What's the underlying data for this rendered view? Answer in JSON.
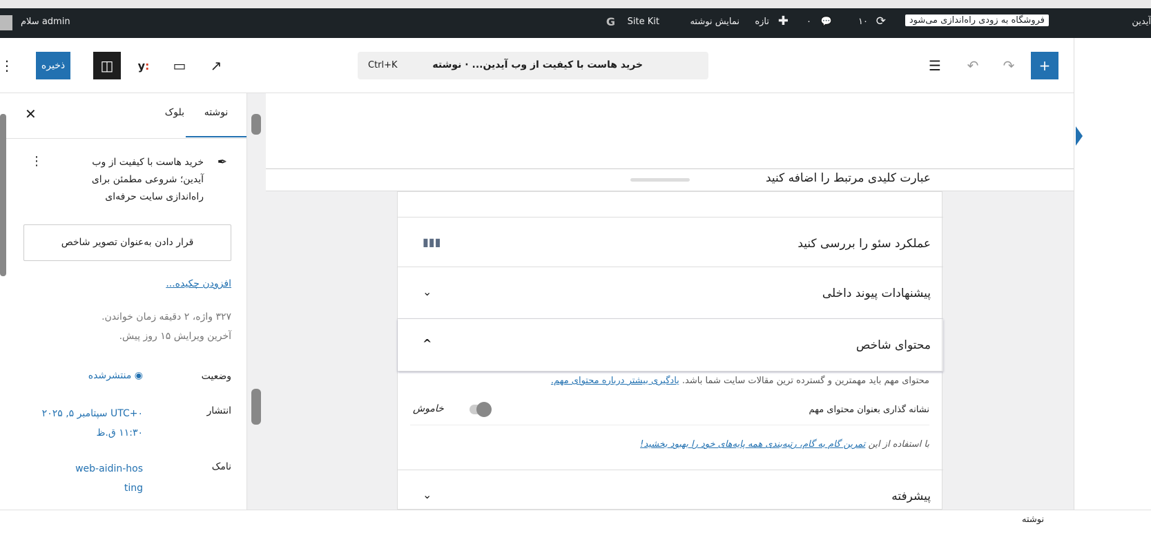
{
  "adminbar": {
    "site": "آیدین",
    "notice": "فروشگاه به زودی راه‌اندازی می‌شود",
    "updates": "۱۰",
    "comments": "۰",
    "new": "تازه",
    "view_post": "نمایش نوشته",
    "sitekit": "Site Kit",
    "greeting": "سلام admin"
  },
  "toolbar": {
    "save": "ذخیره",
    "doc_title": "خرید هاست با کیفیت از وب آیدین... · نوشته",
    "shortcut": "Ctrl+K"
  },
  "sidebar": {
    "tabs": [
      {
        "label": "نوشته"
      },
      {
        "label": "بلوک"
      }
    ],
    "post_title": "خرید هاست با کیفیت از وب آیدین؛ شروعی مطمئن برای راه‌اندازی سایت حرفه‌ای",
    "featured_image": "قرار دادن به‌عنوان تصویر شاخص",
    "excerpt_link": "افزودن چکیده...",
    "stats": "۳۲۷ واژه، ۲ دقیقه زمان خواندن.",
    "last_edit": "آخرین ویرایش ۱۵ روز پیش.",
    "status_label": "وضعیت",
    "status_value": "منتشرشده",
    "publish_label": "انتشار",
    "publish_value": "UTC+۰ سپتامبر ۵, ۲۰۲۵ ۱۱:۳۰ ق.ظ",
    "slug_label": "نامک",
    "slug_value": "web-aidin-hosting"
  },
  "yoast": {
    "keyphrase": "عبارت کلیدی مرتبط را اضافه کنید",
    "seo": "عملکرد سئو را بررسی کنید",
    "links": "پیشنهادات پیوند داخلی",
    "cornerstone": "محتوای شاخص",
    "cornerstone_desc": "محتوای مهم باید مهمترین و گسترده ترین مقالات سایت شما باشد.",
    "cornerstone_link": "یادگیری بیشتر درباره محتوای مهم.",
    "toggle_label": "نشانه گذاری بعنوان محتوای مهم",
    "toggle_state": "خاموش",
    "toggle_on": false,
    "workout_prefix": "با استفاده از این",
    "workout_link": "تمرین گام به گام، رتبه‌بندی همه پایه‌های خود را بهبود بخشید!",
    "advanced": "پیشرفته"
  },
  "footer": {
    "breadcrumb": "نوشته"
  },
  "colors": {
    "accent": "#2271b1",
    "adminbar": "#1d2327"
  }
}
